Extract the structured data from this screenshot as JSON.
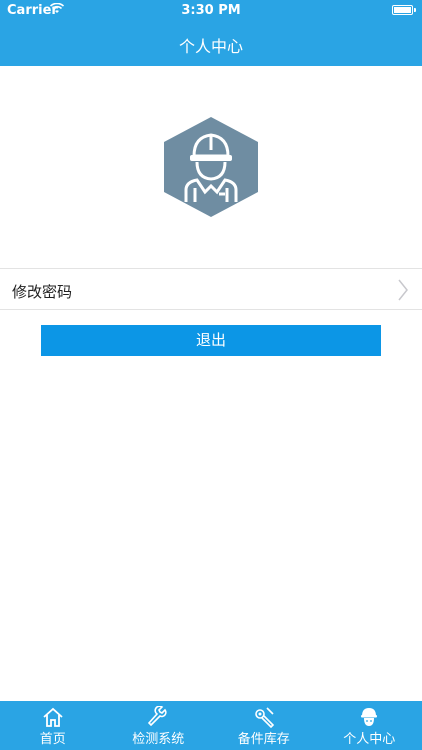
{
  "status_bar": {
    "carrier": "Carrier",
    "time": "3:30 PM"
  },
  "header": {
    "title": "个人中心"
  },
  "profile": {
    "avatar_icon": "worker-hard-hat-icon",
    "hex_color": "#6f8da2"
  },
  "menu": {
    "change_password": "修改密码"
  },
  "actions": {
    "logout": "退出"
  },
  "tabs": [
    {
      "label": "首页",
      "icon": "home-icon"
    },
    {
      "label": "检测系统",
      "icon": "wrench-icon"
    },
    {
      "label": "备件库存",
      "icon": "parts-icon"
    },
    {
      "label": "个人中心",
      "icon": "worker-icon"
    }
  ],
  "colors": {
    "header": "#2aa4e4",
    "button": "#0c96e6"
  }
}
